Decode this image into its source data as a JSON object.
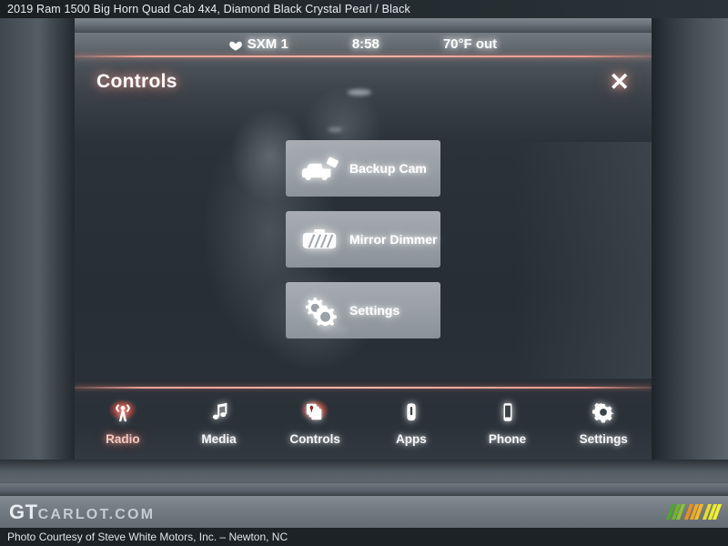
{
  "listing": {
    "title": "2019 Ram 1500 Big Horn Quad Cab 4x4,  Diamond Black Crystal Pearl / Black"
  },
  "infotainment": {
    "status_bar": {
      "source_icon": "sirius-xm-icon",
      "source": "SXM 1",
      "time": "8:58",
      "temperature": "70°F out"
    },
    "header": {
      "title": "Controls",
      "close_label": "✕",
      "close_icon": "close-icon"
    },
    "controls": [
      {
        "label": "Backup Cam",
        "icon": "truck-backup-camera-icon"
      },
      {
        "label": "Mirror Dimmer",
        "icon": "rearview-mirror-icon"
      },
      {
        "label": "Settings",
        "icon": "gears-icon"
      }
    ],
    "nav": [
      {
        "label": "Radio",
        "icon": "broadcast-tower-icon",
        "active": true,
        "tinted": true
      },
      {
        "label": "Media",
        "icon": "music-note-icon",
        "active": false,
        "tinted": false
      },
      {
        "label": "Controls",
        "icon": "layers-icon",
        "active": true,
        "tinted": false
      },
      {
        "label": "Apps",
        "icon": "apps-icon",
        "active": false,
        "tinted": false
      },
      {
        "label": "Phone",
        "icon": "phone-icon",
        "active": false,
        "tinted": false
      },
      {
        "label": "Settings",
        "icon": "gear-icon",
        "active": false,
        "tinted": false
      }
    ]
  },
  "watermark": {
    "logo_primary": "GT",
    "logo_secondary": "CARLOT.COM",
    "bar_colors": [
      "#4aa82a",
      "#6db32c",
      "#8ec22e",
      "#e8911c",
      "#f0a61e",
      "#f5bb22",
      "#e8e022",
      "#eeea26",
      "#f4f22a"
    ]
  },
  "footer": {
    "courtesy": "Photo Courtesy of Steve White Motors, Inc. – Newton, NC"
  },
  "colors": {
    "accent_red": "#e83c28",
    "divider_red": "#ffb4a5",
    "button_face": "#a8aeb4",
    "screen_bg": "#272e35"
  }
}
